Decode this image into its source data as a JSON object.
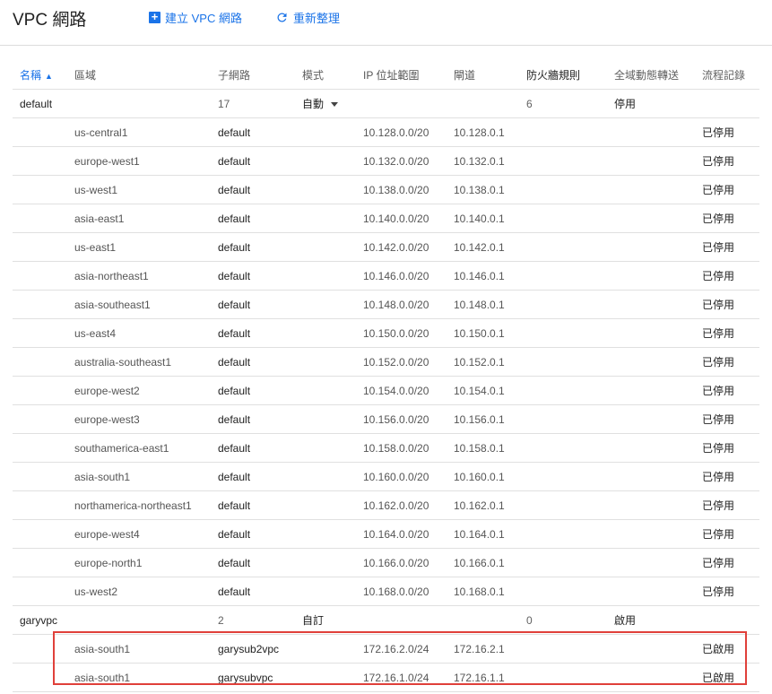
{
  "header": {
    "title": "VPC 網路",
    "create_label": "建立 VPC 網路",
    "refresh_label": "重新整理"
  },
  "columns": {
    "name": "名稱",
    "region": "區域",
    "subnet": "子網路",
    "mode": "模式",
    "ip_range": "IP 位址範圍",
    "gateway": "閘道",
    "firewall": "防火牆規則",
    "routing": "全域動態轉送",
    "flow_logs": "流程記錄"
  },
  "networks": [
    {
      "name": "default",
      "subnet_count": "17",
      "mode": "自動",
      "firewall": "6",
      "routing": "停用",
      "subnets": [
        {
          "region": "us-central1",
          "name": "default",
          "ip": "10.128.0.0/20",
          "gw": "10.128.0.1",
          "flow": "已停用"
        },
        {
          "region": "europe-west1",
          "name": "default",
          "ip": "10.132.0.0/20",
          "gw": "10.132.0.1",
          "flow": "已停用"
        },
        {
          "region": "us-west1",
          "name": "default",
          "ip": "10.138.0.0/20",
          "gw": "10.138.0.1",
          "flow": "已停用"
        },
        {
          "region": "asia-east1",
          "name": "default",
          "ip": "10.140.0.0/20",
          "gw": "10.140.0.1",
          "flow": "已停用"
        },
        {
          "region": "us-east1",
          "name": "default",
          "ip": "10.142.0.0/20",
          "gw": "10.142.0.1",
          "flow": "已停用"
        },
        {
          "region": "asia-northeast1",
          "name": "default",
          "ip": "10.146.0.0/20",
          "gw": "10.146.0.1",
          "flow": "已停用"
        },
        {
          "region": "asia-southeast1",
          "name": "default",
          "ip": "10.148.0.0/20",
          "gw": "10.148.0.1",
          "flow": "已停用"
        },
        {
          "region": "us-east4",
          "name": "default",
          "ip": "10.150.0.0/20",
          "gw": "10.150.0.1",
          "flow": "已停用"
        },
        {
          "region": "australia-southeast1",
          "name": "default",
          "ip": "10.152.0.0/20",
          "gw": "10.152.0.1",
          "flow": "已停用"
        },
        {
          "region": "europe-west2",
          "name": "default",
          "ip": "10.154.0.0/20",
          "gw": "10.154.0.1",
          "flow": "已停用"
        },
        {
          "region": "europe-west3",
          "name": "default",
          "ip": "10.156.0.0/20",
          "gw": "10.156.0.1",
          "flow": "已停用"
        },
        {
          "region": "southamerica-east1",
          "name": "default",
          "ip": "10.158.0.0/20",
          "gw": "10.158.0.1",
          "flow": "已停用"
        },
        {
          "region": "asia-south1",
          "name": "default",
          "ip": "10.160.0.0/20",
          "gw": "10.160.0.1",
          "flow": "已停用"
        },
        {
          "region": "northamerica-northeast1",
          "name": "default",
          "ip": "10.162.0.0/20",
          "gw": "10.162.0.1",
          "flow": "已停用"
        },
        {
          "region": "europe-west4",
          "name": "default",
          "ip": "10.164.0.0/20",
          "gw": "10.164.0.1",
          "flow": "已停用"
        },
        {
          "region": "europe-north1",
          "name": "default",
          "ip": "10.166.0.0/20",
          "gw": "10.166.0.1",
          "flow": "已停用"
        },
        {
          "region": "us-west2",
          "name": "default",
          "ip": "10.168.0.0/20",
          "gw": "10.168.0.1",
          "flow": "已停用"
        }
      ]
    },
    {
      "name": "garyvpc",
      "subnet_count": "2",
      "mode": "自訂",
      "firewall": "0",
      "routing": "啟用",
      "subnets": [
        {
          "region": "asia-south1",
          "name": "garysub2vpc",
          "ip": "172.16.2.0/24",
          "gw": "172.16.2.1",
          "flow": "已啟用"
        },
        {
          "region": "asia-south1",
          "name": "garysubvpc",
          "ip": "172.16.1.0/24",
          "gw": "172.16.1.1",
          "flow": "已啟用"
        }
      ]
    }
  ],
  "colors": {
    "accent": "#1a73e8",
    "highlight": "#e0403a"
  }
}
